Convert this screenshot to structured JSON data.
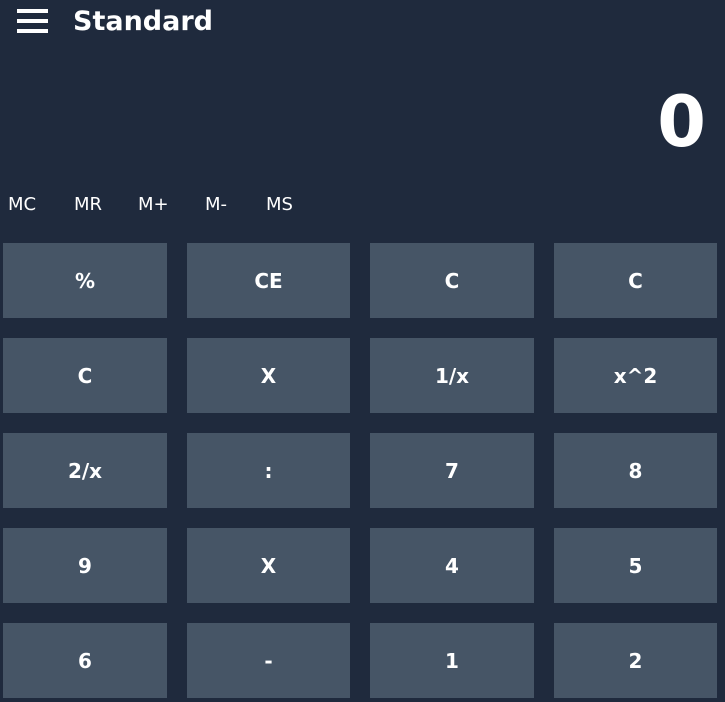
{
  "header": {
    "menu_icon": "hamburger-menu-icon",
    "title": "Standard"
  },
  "display": {
    "value": "0"
  },
  "memory": [
    "MC",
    "MR",
    "M+",
    "M-",
    "MS"
  ],
  "keypad": [
    [
      "%",
      "CE",
      "C",
      "C"
    ],
    [
      "C",
      "X",
      "1/x",
      "x^2"
    ],
    [
      "2/x",
      ":",
      "7",
      "8"
    ],
    [
      "9",
      "X",
      "4",
      "5"
    ],
    [
      "6",
      "-",
      "1",
      "2"
    ]
  ],
  "colors": {
    "background": "#1f2a3d",
    "key_background": "#465566",
    "text": "#ffffff"
  }
}
